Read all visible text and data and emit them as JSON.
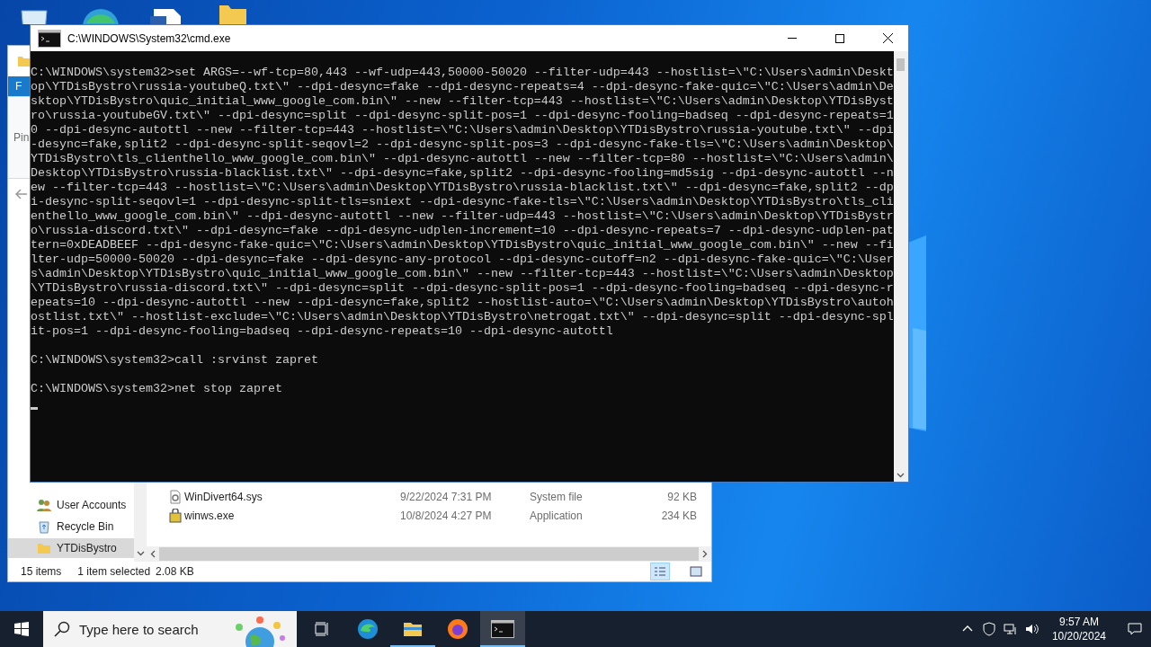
{
  "explorer": {
    "ribbon_tab": "F",
    "pin_label": "Pin",
    "nav_items": [
      {
        "label": "User Accounts",
        "kind": "users",
        "selected": false
      },
      {
        "label": "Recycle Bin",
        "kind": "recycle",
        "selected": false
      },
      {
        "label": "YTDisBystro",
        "kind": "folder",
        "selected": true
      }
    ],
    "files": [
      {
        "name": "WinDivert64.sys",
        "kind": "sys",
        "date": "9/22/2024 7:31 PM",
        "type": "System file",
        "size": "92 KB"
      },
      {
        "name": "winws.exe",
        "kind": "exe",
        "date": "10/8/2024 4:27 PM",
        "type": "Application",
        "size": "234 KB"
      }
    ],
    "status": {
      "count": "15 items",
      "selection": "1 item selected",
      "size": "2.08 KB"
    }
  },
  "console": {
    "title": "C:\\WINDOWS\\System32\\cmd.exe",
    "blocks": [
      {
        "lines": [
          "C:\\WINDOWS\\system32>set ARGS=--wf-tcp=80,443 --wf-udp=443,50000-50020 --filter-udp=443 --hostlist=\\\"C:\\Users\\admin\\Deskt",
          "op\\YTDisBystro\\russia-youtubeQ.txt\\\" --dpi-desync=fake --dpi-desync-repeats=4 --dpi-desync-fake-quic=\\\"C:\\Users\\admin\\De",
          "sktop\\YTDisBystro\\quic_initial_www_google_com.bin\\\" --new --filter-tcp=443 --hostlist=\\\"C:\\Users\\admin\\Desktop\\YTDisByst",
          "ro\\russia-youtubeGV.txt\\\" --dpi-desync=split --dpi-desync-split-pos=1 --dpi-desync-fooling=badseq --dpi-desync-repeats=1",
          "0 --dpi-desync-autottl --new --filter-tcp=443 --hostlist=\\\"C:\\Users\\admin\\Desktop\\YTDisBystro\\russia-youtube.txt\\\" --dpi",
          "-desync=fake,split2 --dpi-desync-split-seqovl=2 --dpi-desync-split-pos=3 --dpi-desync-fake-tls=\\\"C:\\Users\\admin\\Desktop\\",
          "YTDisBystro\\tls_clienthello_www_google_com.bin\\\" --dpi-desync-autottl --new --filter-tcp=80 --hostlist=\\\"C:\\Users\\admin\\",
          "Desktop\\YTDisBystro\\russia-blacklist.txt\\\" --dpi-desync=fake,split2 --dpi-desync-fooling=md5sig --dpi-desync-autottl --n",
          "ew --filter-tcp=443 --hostlist=\\\"C:\\Users\\admin\\Desktop\\YTDisBystro\\russia-blacklist.txt\\\" --dpi-desync=fake,split2 --dp",
          "i-desync-split-seqovl=1 --dpi-desync-split-tls=sniext --dpi-desync-fake-tls=\\\"C:\\Users\\admin\\Desktop\\YTDisBystro\\tls_cli",
          "enthello_www_google_com.bin\\\" --dpi-desync-autottl --new --filter-udp=443 --hostlist=\\\"C:\\Users\\admin\\Desktop\\YTDisBystr",
          "o\\russia-discord.txt\\\" --dpi-desync=fake --dpi-desync-udplen-increment=10 --dpi-desync-repeats=7 --dpi-desync-udplen-pat",
          "tern=0xDEADBEEF --dpi-desync-fake-quic=\\\"C:\\Users\\admin\\Desktop\\YTDisBystro\\quic_initial_www_google_com.bin\\\" --new --fi",
          "lter-udp=50000-50020 --dpi-desync=fake --dpi-desync-any-protocol --dpi-desync-cutoff=n2 --dpi-desync-fake-quic=\\\"C:\\User",
          "s\\admin\\Desktop\\YTDisBystro\\quic_initial_www_google_com.bin\\\" --new --filter-tcp=443 --hostlist=\\\"C:\\Users\\admin\\Desktop",
          "\\YTDisBystro\\russia-discord.txt\\\" --dpi-desync=split --dpi-desync-split-pos=1 --dpi-desync-fooling=badseq --dpi-desync-r",
          "epeats=10 --dpi-desync-autottl --new --dpi-desync=fake,split2 --hostlist-auto=\\\"C:\\Users\\admin\\Desktop\\YTDisBystro\\autoh",
          "ostlist.txt\\\" --hostlist-exclude=\\\"C:\\Users\\admin\\Desktop\\YTDisBystro\\netrogat.txt\\\" --dpi-desync=split --dpi-desync-spl",
          "it-pos=1 --dpi-desync-fooling=badseq --dpi-desync-repeats=10 --dpi-desync-autottl"
        ]
      },
      {
        "lines": [
          "C:\\WINDOWS\\system32>call :srvinst zapret"
        ]
      },
      {
        "lines": [
          "C:\\WINDOWS\\system32>net stop zapret"
        ]
      }
    ]
  },
  "taskbar": {
    "search_placeholder": "Type here to search",
    "apps": [
      {
        "kind": "edge",
        "running": false,
        "active": false
      },
      {
        "kind": "explorer",
        "running": true,
        "active": false
      },
      {
        "kind": "firefox",
        "running": false,
        "active": false
      },
      {
        "kind": "cmd",
        "running": true,
        "active": true
      }
    ],
    "time": "9:57 AM",
    "date": "10/20/2024"
  }
}
